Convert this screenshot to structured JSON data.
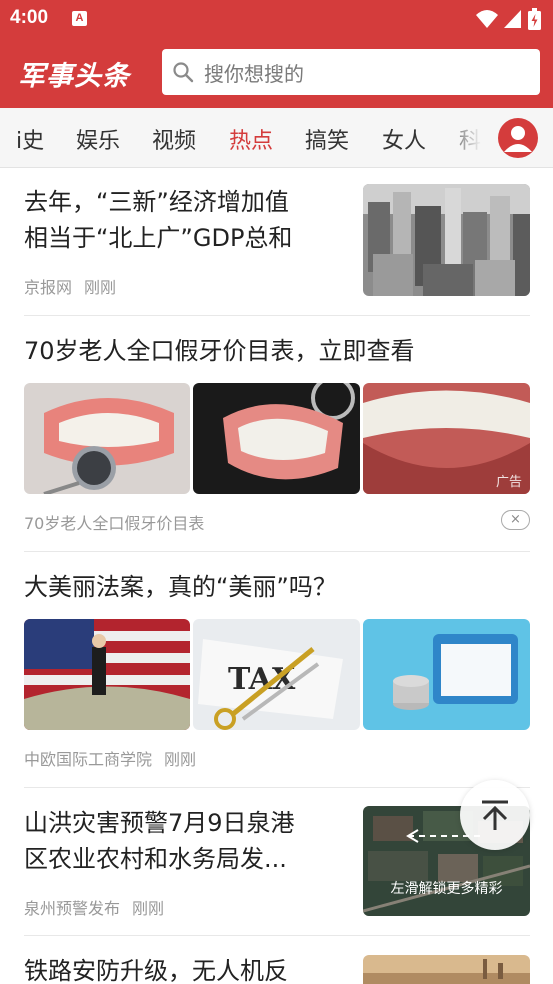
{
  "status_bar": {
    "time": "4:00",
    "notification_glyph": "A",
    "icons": [
      "wifi-icon",
      "signal-icon",
      "battery-charging-icon"
    ]
  },
  "header": {
    "logo_text": "军事头条",
    "search_placeholder": "搜你想搜的",
    "accent_color": "#d43c3c"
  },
  "tabs": [
    {
      "label": "历史",
      "visible_text": "i史"
    },
    {
      "label": "娱乐"
    },
    {
      "label": "视频"
    },
    {
      "label": "热点",
      "active": true
    },
    {
      "label": "搞笑"
    },
    {
      "label": "女人"
    },
    {
      "label": "科"
    }
  ],
  "feed": [
    {
      "type": "single_image",
      "title": "去年，“三新”经济增加值相当于“北上广”GDP总和",
      "title_line1": "去年，“三新”经济增加值",
      "title_line2": "相当于“北上广”GDP总和",
      "source": "京报网",
      "time": "刚刚",
      "image": "city-skyline-image"
    },
    {
      "type": "ad_three_images",
      "title": "70岁老人全口假牙价目表，立即查看",
      "description": "70岁老人全口假牙价目表",
      "ad_label": "广告",
      "close_glyph": "×",
      "images": [
        "dentures-mirror-image",
        "dentures-glasses-image",
        "teeth-closeup-image"
      ]
    },
    {
      "type": "three_images",
      "title": "大美丽法案，真的“美丽”吗？",
      "source": "中欧国际工商学院",
      "time": "刚刚",
      "images": [
        "flag-dollar-image",
        "tax-scissors-image",
        "coins-card-image"
      ]
    },
    {
      "type": "single_image",
      "title": "山洪灾害预警7月9日泉港区农业农村和水务局发...",
      "title_line1": "山洪灾害预警7月9日泉港",
      "title_line2": "区农业农村和水务局发...",
      "source": "泉州预警发布",
      "time": "刚刚",
      "image": "aerial-village-image",
      "overlay_text": "左滑解锁更多精彩"
    },
    {
      "type": "single_image",
      "title": "铁路安防升级，无人机反",
      "image": "sunset-city-image"
    }
  ],
  "floating": {
    "back_to_top": "arrow-up-to-top-icon"
  }
}
